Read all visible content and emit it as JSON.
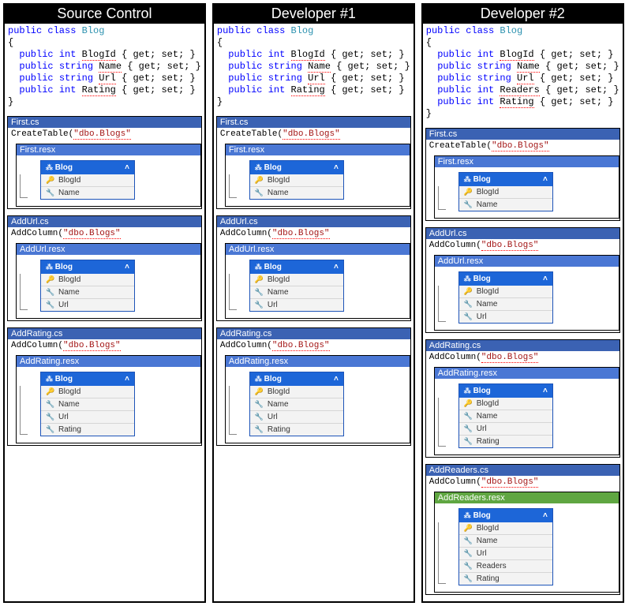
{
  "columns": [
    {
      "title": "Source Control",
      "code": {
        "decl": "public class",
        "cls": "Blog",
        "props": [
          {
            "kw": "public",
            "type": "int",
            "name": "BlogId",
            "acc": "{ get; set; }"
          },
          {
            "kw": "public",
            "type": "string",
            "name": "Name",
            "acc": "{ get; set; }"
          },
          {
            "kw": "public",
            "type": "string",
            "name": "Url",
            "acc": "{ get; set; }"
          },
          {
            "kw": "public",
            "type": "int",
            "name": "Rating",
            "acc": "{ get; set; }"
          }
        ]
      },
      "migrations": [
        {
          "csName": "First.cs",
          "call": "CreateTable",
          "arg": "\"dbo.Blogs\"",
          "resxName": "First.resx",
          "resxClass": "resx",
          "entity": "Blog",
          "cols": [
            "BlogId",
            "Name"
          ]
        },
        {
          "csName": "AddUrl.cs",
          "call": "AddColumn",
          "arg": "\"dbo.Blogs\"",
          "resxName": "AddUrl.resx",
          "resxClass": "resx",
          "entity": "Blog",
          "cols": [
            "BlogId",
            "Name",
            "Url"
          ]
        },
        {
          "csName": "AddRating.cs",
          "call": "AddColumn",
          "arg": "\"dbo.Blogs\"",
          "resxName": "AddRating.resx",
          "resxClass": "resx",
          "entity": "Blog",
          "cols": [
            "BlogId",
            "Name",
            "Url",
            "Rating"
          ]
        }
      ]
    },
    {
      "title": "Developer #1",
      "code": {
        "decl": "public class",
        "cls": "Blog",
        "props": [
          {
            "kw": "public",
            "type": "int",
            "name": "BlogId",
            "acc": "{ get; set; }"
          },
          {
            "kw": "public",
            "type": "string",
            "name": "Name",
            "acc": "{ get; set; }"
          },
          {
            "kw": "public",
            "type": "string",
            "name": "Url",
            "acc": "{ get; set; }"
          },
          {
            "kw": "public",
            "type": "int",
            "name": "Rating",
            "acc": "{ get; set; }"
          }
        ]
      },
      "migrations": [
        {
          "csName": "First.cs",
          "call": "CreateTable",
          "arg": "\"dbo.Blogs\"",
          "resxName": "First.resx",
          "resxClass": "resx",
          "entity": "Blog",
          "cols": [
            "BlogId",
            "Name"
          ]
        },
        {
          "csName": "AddUrl.cs",
          "call": "AddColumn",
          "arg": "\"dbo.Blogs\"",
          "resxName": "AddUrl.resx",
          "resxClass": "resx",
          "entity": "Blog",
          "cols": [
            "BlogId",
            "Name",
            "Url"
          ]
        },
        {
          "csName": "AddRating.cs",
          "call": "AddColumn",
          "arg": "\"dbo.Blogs\"",
          "resxName": "AddRating.resx",
          "resxClass": "resx",
          "entity": "Blog",
          "cols": [
            "BlogId",
            "Name",
            "Url",
            "Rating"
          ]
        }
      ]
    },
    {
      "title": "Developer #2",
      "code": {
        "decl": "public class",
        "cls": "Blog",
        "props": [
          {
            "kw": "public",
            "type": "int",
            "name": "BlogId",
            "acc": "{ get; set; }"
          },
          {
            "kw": "public",
            "type": "string",
            "name": "Name",
            "acc": "{ get; set; }"
          },
          {
            "kw": "public",
            "type": "string",
            "name": "Url",
            "acc": "{ get; set; }"
          },
          {
            "kw": "public",
            "type": "int",
            "name": "Readers",
            "acc": "{ get; set; }"
          },
          {
            "kw": "public",
            "type": "int",
            "name": "Rating",
            "acc": "{ get; set; }"
          }
        ]
      },
      "migrations": [
        {
          "csName": "First.cs",
          "call": "CreateTable",
          "arg": "\"dbo.Blogs\"",
          "resxName": "First.resx",
          "resxClass": "resx",
          "entity": "Blog",
          "cols": [
            "BlogId",
            "Name"
          ]
        },
        {
          "csName": "AddUrl.cs",
          "call": "AddColumn",
          "arg": "\"dbo.Blogs\"",
          "resxName": "AddUrl.resx",
          "resxClass": "resx",
          "entity": "Blog",
          "cols": [
            "BlogId",
            "Name",
            "Url"
          ]
        },
        {
          "csName": "AddRating.cs",
          "call": "AddColumn",
          "arg": "\"dbo.Blogs\"",
          "resxName": "AddRating.resx",
          "resxClass": "resx",
          "entity": "Blog",
          "cols": [
            "BlogId",
            "Name",
            "Url",
            "Rating"
          ]
        },
        {
          "csName": "AddReaders.cs",
          "call": "AddColumn",
          "arg": "\"dbo.Blogs\"",
          "resxName": "AddReaders.resx",
          "resxClass": "green",
          "entity": "Blog",
          "cols": [
            "BlogId",
            "Name",
            "Url",
            "Readers",
            "Rating"
          ]
        }
      ]
    }
  ],
  "icons": {
    "key": "🔑",
    "wrench": "🔧",
    "ent": "✦",
    "chev": "˄"
  }
}
